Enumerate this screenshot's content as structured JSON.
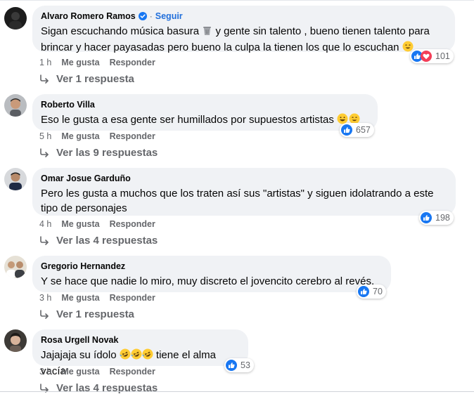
{
  "comments": [
    {
      "author": "Alvaro Romero Ramos",
      "follow_label": "Seguir",
      "dot": "·",
      "text_parts": [
        "Sigan escuchando música basura ",
        " y gente sin talento , bueno tienen talento para brincar y hacer payasadas pero bueno la culpa la tienen los que lo escuchan "
      ],
      "time": "1 h",
      "like_label": "Me gusta",
      "reply_label": "Responder",
      "reaction_count": "101",
      "replies_label": "Ver 1 respuesta"
    },
    {
      "author": "Roberto Villa",
      "text": "Eso le gusta a esa gente ser humillados por supuestos artistas ",
      "time": "5 h",
      "like_label": "Me gusta",
      "reply_label": "Responder",
      "reaction_count": "657",
      "replies_label": "Ver las 9 respuestas"
    },
    {
      "author": "Omar Josue Garduño",
      "text": "Pero les gusta a muchos que los traten así sus \"artistas\" y siguen idolatrando a este tipo de personajes",
      "time": "4 h",
      "like_label": "Me gusta",
      "reply_label": "Responder",
      "reaction_count": "198",
      "replies_label": "Ver las 4 respuestas"
    },
    {
      "author": "Gregorio Hernandez",
      "text": "Y se hace que nadie lo miro, muy discreto el jovencito cerebro al revés.",
      "time": "3 h",
      "like_label": "Me gusta",
      "reply_label": "Responder",
      "reaction_count": "70",
      "replies_label": "Ver 1 respuesta"
    },
    {
      "author": "Rosa Urgell Novak",
      "text_parts": [
        "Jajajaja su ídolo ",
        " tiene el alma vacía"
      ],
      "time": "3 h",
      "like_label": "Me gusta",
      "reply_label": "Responder",
      "reaction_count": "53",
      "replies_label": "Ver las 4 respuestas"
    }
  ],
  "colors": {
    "bubble": "#f0f2f5",
    "secondary_text": "#65676b",
    "link_blue": "#216fdb",
    "like_blue": "#1877f2",
    "love_red": "#f33e58"
  }
}
